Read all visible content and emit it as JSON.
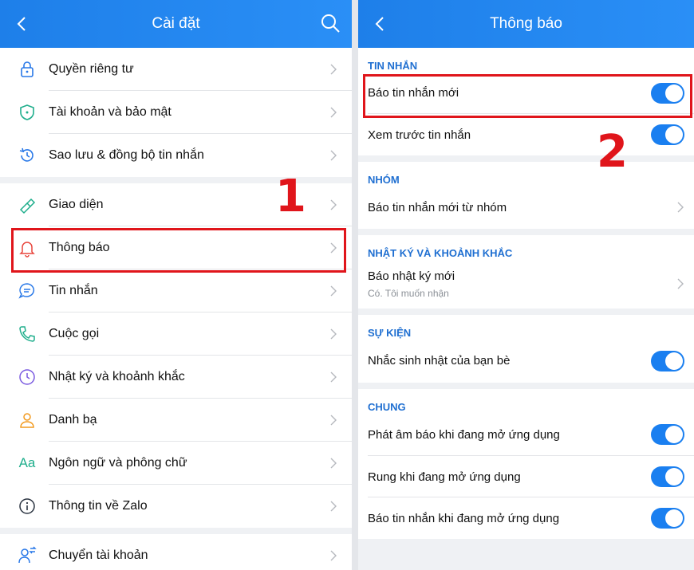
{
  "left": {
    "title": "Cài đặt",
    "groups": [
      [
        {
          "label": "Quyền riêng tư",
          "icon": "lock-icon"
        },
        {
          "label": "Tài khoản và bảo mật",
          "icon": "shield-icon"
        },
        {
          "label": "Sao lưu & đồng bộ tin nhắn",
          "icon": "history-icon"
        }
      ],
      [
        {
          "label": "Giao diện",
          "icon": "brush-icon"
        },
        {
          "label": "Thông báo",
          "icon": "bell-icon"
        },
        {
          "label": "Tin nhắn",
          "icon": "chat-icon"
        },
        {
          "label": "Cuộc gọi",
          "icon": "phone-icon"
        },
        {
          "label": "Nhật ký và khoảnh khắc",
          "icon": "clock-icon"
        },
        {
          "label": "Danh bạ",
          "icon": "person-icon"
        },
        {
          "label": "Ngôn ngữ và phông chữ",
          "icon": "font-icon",
          "icon_text": "Aa"
        },
        {
          "label": "Thông tin về Zalo",
          "icon": "info-icon"
        }
      ],
      [
        {
          "label": "Chuyển tài khoản",
          "icon": "switch-account-icon"
        }
      ]
    ]
  },
  "right": {
    "title": "Thông báo",
    "sections": {
      "messages": {
        "title": "TIN NHẮN",
        "new_message": "Báo tin nhắn mới",
        "preview": "Xem trước tin nhắn"
      },
      "groups": {
        "title": "NHÓM",
        "group_message": "Báo tin nhắn mới từ nhóm"
      },
      "diary": {
        "title": "NHẬT KÝ VÀ KHOẢNH KHẮC",
        "new_diary": "Báo nhật ký mới",
        "new_diary_sub": "Có. Tôi muốn nhận"
      },
      "events": {
        "title": "SỰ KIỆN",
        "birthday": "Nhắc sinh nhật của bạn bè"
      },
      "general": {
        "title": "CHUNG",
        "sound": "Phát âm báo khi đang mở ứng dụng",
        "vibrate": "Rung khi đang mở ứng dụng",
        "notify_in_app": "Báo tin nhắn khi đang mở ứng dụng"
      }
    }
  },
  "annotations": {
    "step1": "1",
    "step2": "2"
  },
  "colors": {
    "accent": "#1a7ff0",
    "highlight": "#e0151b"
  }
}
